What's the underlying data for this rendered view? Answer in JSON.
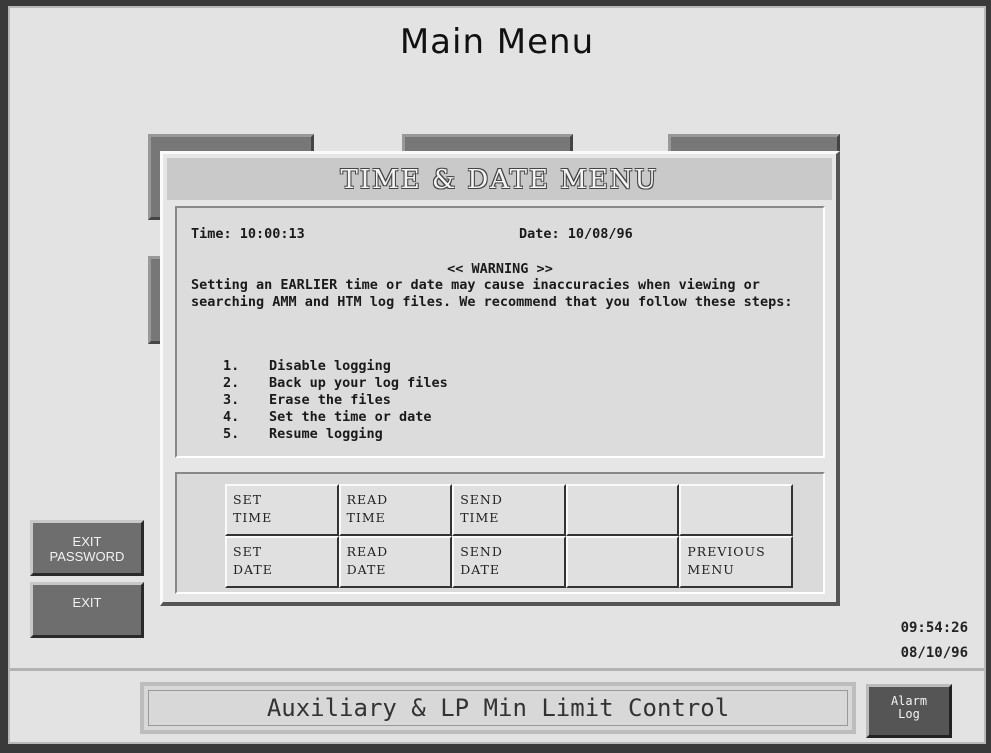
{
  "main_title": "Main Menu",
  "dialog": {
    "title": "TIME & DATE MENU",
    "time_label": "Time: 10:00:13",
    "date_label": "Date: 10/08/96",
    "warning_header": "<< WARNING >>",
    "warning_text": "Setting an EARLIER time or date may cause inaccuracies when viewing or searching AMM and HTM log files.  We recommend that you follow these steps:",
    "steps": [
      {
        "num": "1.",
        "text": "Disable logging"
      },
      {
        "num": "2.",
        "text": "Back up your log files"
      },
      {
        "num": "3.",
        "text": "Erase the files"
      },
      {
        "num": "4.",
        "text": "Set the time or date"
      },
      {
        "num": "5.",
        "text": "Resume logging"
      }
    ],
    "buttons": {
      "set_time": [
        "SET",
        "TIME"
      ],
      "read_time": [
        "READ",
        "TIME"
      ],
      "send_time": [
        "SEND",
        "TIME"
      ],
      "set_date": [
        "SET",
        "DATE"
      ],
      "read_date": [
        "READ",
        "DATE"
      ],
      "send_date": [
        "SEND",
        "DATE"
      ],
      "previous_menu": [
        "PREVIOUS",
        "MENU"
      ]
    }
  },
  "side": {
    "exit_password_line1": "EXIT",
    "exit_password_line2": "PASSWORD",
    "exit": "EXIT"
  },
  "clock": {
    "time": "09:54:26",
    "date": "08/10/96"
  },
  "footer": {
    "title": "Auxiliary & LP Min Limit Control",
    "alarm_line1": "Alarm",
    "alarm_line2": "Log"
  }
}
